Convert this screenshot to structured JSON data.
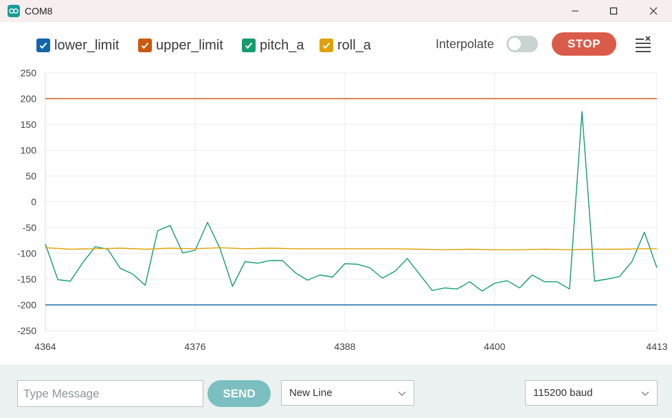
{
  "window": {
    "title": "COM8",
    "icon": "arduino-icon",
    "controls": [
      "minimize-icon",
      "maximize-icon",
      "close-icon"
    ]
  },
  "legend": {
    "items": [
      {
        "label": "lower_limit",
        "checked": true,
        "color": "#1565a8"
      },
      {
        "label": "upper_limit",
        "checked": true,
        "color": "#c9590f"
      },
      {
        "label": "pitch_a",
        "checked": true,
        "color": "#149c6e"
      },
      {
        "label": "roll_a",
        "checked": true,
        "color": "#e0a106"
      }
    ]
  },
  "toolbar": {
    "interpolate_label": "Interpolate",
    "interpolate_on": false,
    "stop_label": "STOP",
    "clear_icon": "clear-list-icon"
  },
  "chart_data": {
    "type": "line",
    "ylim": [
      -250,
      250
    ],
    "xlim": [
      4364,
      4413
    ],
    "yticks": [
      "250",
      "200",
      "150",
      "100",
      "50",
      "0",
      "-50",
      "-100",
      "-150",
      "-200",
      "-250"
    ],
    "xticks": [
      "4364",
      "4376",
      "4388",
      "4400",
      "4413"
    ],
    "grid": true,
    "series": [
      {
        "name": "lower_limit",
        "color": "#1565a8",
        "constant": -200
      },
      {
        "name": "upper_limit",
        "color": "#c9590f",
        "constant": 200
      },
      {
        "name": "pitch_a",
        "color": "#149c6e",
        "x": [
          4364,
          4365,
          4366,
          4367,
          4368,
          4369,
          4370,
          4371,
          4372,
          4373,
          4374,
          4375,
          4376,
          4377,
          4378,
          4379,
          4380,
          4381,
          4382,
          4383,
          4384,
          4385,
          4386,
          4387,
          4388,
          4389,
          4390,
          4391,
          4392,
          4393,
          4394,
          4395,
          4396,
          4397,
          4398,
          4399,
          4400,
          4401,
          4402,
          4403,
          4404,
          4405,
          4406,
          4407,
          4408,
          4409,
          4410,
          4411,
          4412,
          4413
        ],
        "values": [
          -82,
          -151,
          -154,
          -118,
          -87,
          -92,
          -129,
          -140,
          -162,
          -56,
          -46,
          -99,
          -94,
          -40,
          -91,
          -164,
          -116,
          -119,
          -114,
          -114,
          -137,
          -152,
          -142,
          -146,
          -120,
          -121,
          -128,
          -148,
          -135,
          -110,
          -141,
          -172,
          -167,
          -169,
          -155,
          -173,
          -158,
          -153,
          -167,
          -142,
          -155,
          -155,
          -169,
          175,
          -154,
          -150,
          -145,
          -116,
          -59,
          -128
        ]
      },
      {
        "name": "roll_a",
        "color": "#e0a106",
        "x": [
          4364,
          4366,
          4368,
          4370,
          4372,
          4374,
          4376,
          4378,
          4380,
          4382,
          4384,
          4386,
          4388,
          4390,
          4392,
          4394,
          4396,
          4398,
          4400,
          4402,
          4404,
          4406,
          4408,
          4410,
          4412,
          4413
        ],
        "values": [
          -89,
          -92,
          -91,
          -90,
          -92,
          -90,
          -91,
          -89,
          -91,
          -90,
          -91,
          -91,
          -91,
          -91,
          -91,
          -92,
          -93,
          -92,
          -93,
          -93,
          -92,
          -93,
          -92,
          -92,
          -91,
          -91
        ]
      }
    ]
  },
  "bottom": {
    "message_placeholder": "Type Message",
    "message_value": "",
    "send_label": "SEND",
    "line_ending": "New Line",
    "baud": "115200 baud"
  }
}
